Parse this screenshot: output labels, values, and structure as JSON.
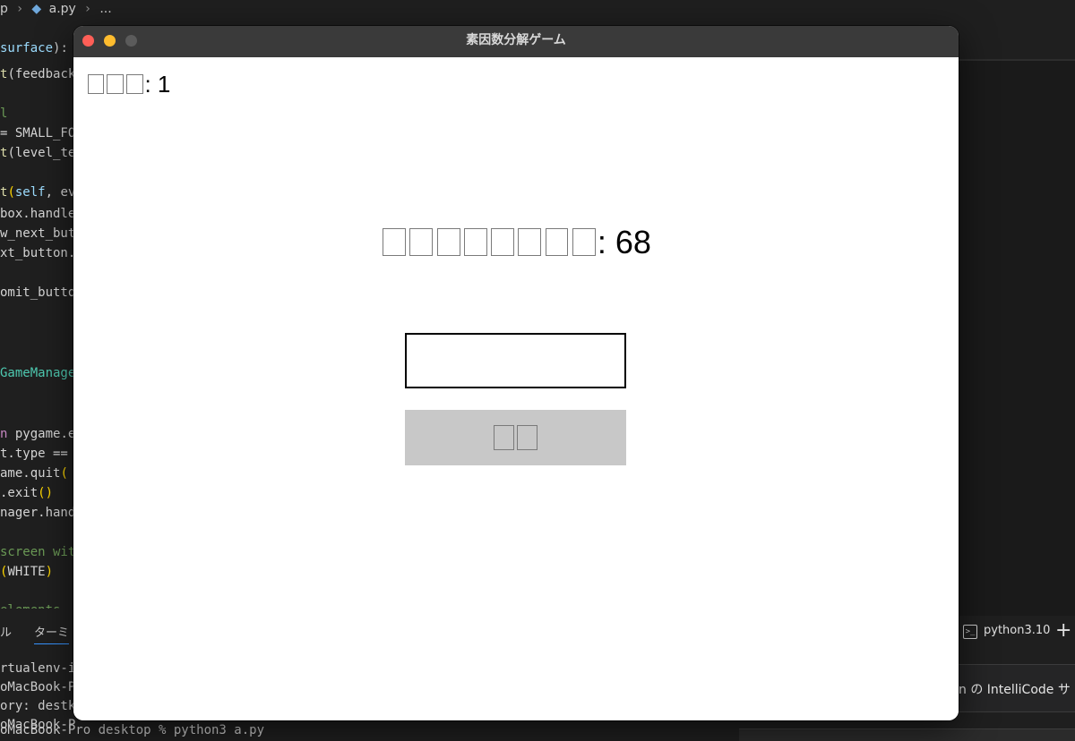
{
  "breadcrumb": {
    "folder": "p",
    "file": "a.py",
    "more": "..."
  },
  "code_lines": [
    [
      "surface",
      "):"
    ],
    [
      "t",
      "(feedback"
    ],
    [
      "l"
    ],
    [
      "= SMALL_FO"
    ],
    [
      "t",
      "(level_te"
    ],
    [
      "t",
      "(",
      "self",
      ", ev"
    ],
    [
      "box.handle"
    ],
    [
      "w_next_but"
    ],
    [
      "xt_button."
    ],
    [
      "omit_butto"
    ],
    [
      "GameManage"
    ],
    [
      "n",
      " pygame.e"
    ],
    [
      "t.type =="
    ],
    [
      "ame.quit",
      "("
    ],
    [
      ".exit",
      "()"
    ],
    [
      "nager.hand"
    ],
    [
      "screen wit"
    ],
    [
      "(",
      "WHITE",
      ")"
    ],
    [
      "elements"
    ]
  ],
  "panel": {
    "tab_left": "ル",
    "tab_terminal": "ターミ"
  },
  "terminal_lines": [
    "rtualenv-i",
    "oMacBook-P",
    "ory: destk",
    "oMacBook-P",
    "oMacBook-Pro desktop % python3 a.py"
  ],
  "terminal_side": {
    "icon": ">_",
    "label": "python3.10",
    "add": "+"
  },
  "intellicode": "n の IntelliCode サ",
  "window": {
    "title": "素因数分解ゲーム"
  },
  "game": {
    "score_label_glyphs": 3,
    "score_value": ": 1",
    "problem_label_glyphs": 8,
    "problem_value": ": 68",
    "answer_value": "",
    "submit_glyphs": 2
  },
  "colors": {
    "editor_bg": "#1f1f1f",
    "close": "#ff5f57",
    "minimize": "#febc2e",
    "maximize": "#5b5b5b",
    "button_bg": "#c8c8c8",
    "missing_glyph_border": "#7a7a7a"
  }
}
